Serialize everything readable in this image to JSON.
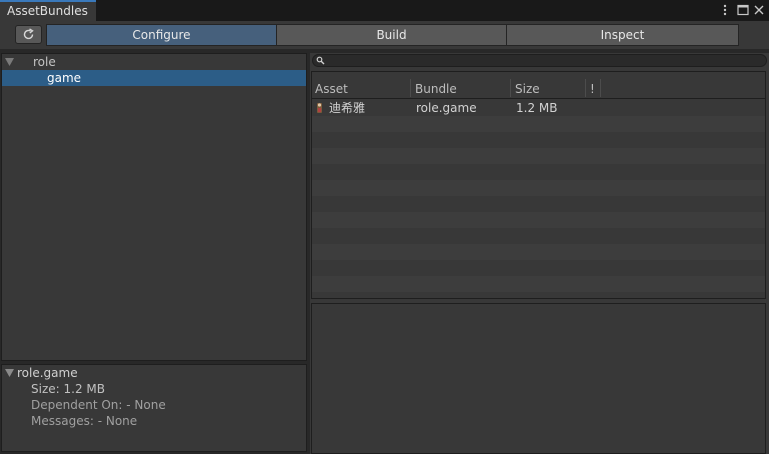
{
  "window": {
    "tab_title": "AssetBundles",
    "menu_icon": "kebab-menu-icon",
    "maximize_icon": "maximize-icon",
    "close_icon": "close-icon"
  },
  "toolbar": {
    "refresh_icon": "refresh-icon",
    "tabs": [
      "Configure",
      "Build",
      "Inspect"
    ],
    "active_tab": "Configure"
  },
  "tree": {
    "items": [
      {
        "label": "role",
        "expanded": true
      },
      {
        "label": "game",
        "selected": true
      }
    ]
  },
  "details": {
    "title": "role.game",
    "lines": [
      "Size: 1.2 MB",
      "Dependent On: - None",
      "Messages: - None"
    ]
  },
  "search": {
    "value": "",
    "icon": "search-icon"
  },
  "table": {
    "columns": [
      "Asset",
      "Bundle",
      "Size",
      "!"
    ],
    "rows": [
      {
        "asset": "迪希雅",
        "bundle": "role.game",
        "size": "1.2 MB",
        "icon": "prefab-icon"
      }
    ]
  },
  "colors": {
    "accent": "#3a79bb",
    "selection": "#2c5d87",
    "active_tab": "#46607c",
    "panel": "#383838"
  }
}
